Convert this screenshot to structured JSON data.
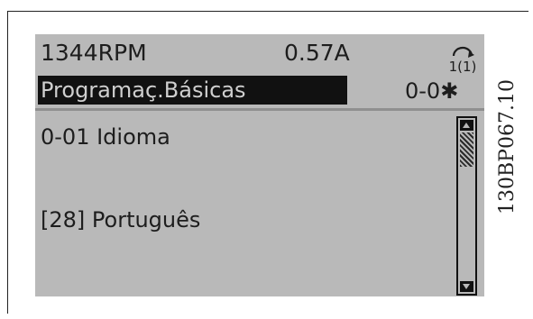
{
  "status": {
    "speed": "1344RPM",
    "current": "0.57A",
    "setup": "1(1)"
  },
  "menu": {
    "title": "Programaç.Básicas",
    "number": "0-0✱"
  },
  "parameter": {
    "name": "0-01 Idioma",
    "value": "[28] Português"
  },
  "figure_code": "130BP067.10",
  "icons": {
    "setup": "setup-cycle-icon",
    "scroll_up": "arrow-up-icon",
    "scroll_down": "arrow-down-icon"
  },
  "colors": {
    "lcd_bg": "#b9b9b9",
    "lcd_text": "#1d1d1d",
    "highlight_bg": "#111111"
  }
}
